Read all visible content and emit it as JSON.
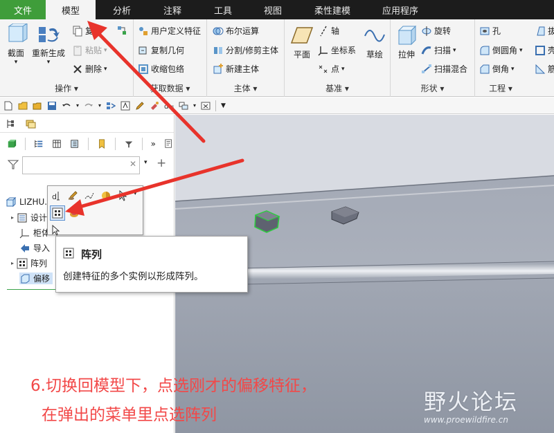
{
  "menu": {
    "tabs": [
      {
        "label": "文件"
      },
      {
        "label": "模型"
      },
      {
        "label": "分析"
      },
      {
        "label": "注释"
      },
      {
        "label": "工具"
      },
      {
        "label": "视图"
      },
      {
        "label": "柔性建模"
      },
      {
        "label": "应用程序"
      }
    ],
    "active": "模型"
  },
  "ribbon": {
    "operations": {
      "label": "操作",
      "section": "截面",
      "regenerate": "重新生成",
      "copy": "复制",
      "paste": "粘贴",
      "delete": "删除"
    },
    "get_data": {
      "label": "获取数据",
      "udf": "用户定义特征",
      "copy_geometry": "复制几何",
      "shrinkwrap": "收缩包络"
    },
    "body": {
      "label": "主体",
      "boolean": "布尔运算",
      "split_trim": "分割/修剪主体",
      "new_body": "新建主体"
    },
    "datum": {
      "label": "基准",
      "plane": "平面",
      "axis": "轴",
      "csys": "坐标系",
      "point": "点",
      "sketch": "草绘"
    },
    "shapes": {
      "label": "形状",
      "extrude": "拉伸",
      "revolve": "旋转",
      "sweep": "扫描",
      "swept_blend": "扫描混合"
    },
    "engineering": {
      "label": "工程",
      "hole": "孔",
      "round": "倒圆角",
      "chamfer": "倒角",
      "draft": "拔",
      "shell": "壳",
      "rib": "筋"
    }
  },
  "tree": {
    "root": "LIZHU...",
    "items": [
      {
        "label": "设计"
      },
      {
        "label": "柜体"
      },
      {
        "label": "导入"
      },
      {
        "label": "阵列"
      },
      {
        "label": "偏移"
      }
    ]
  },
  "tooltip": {
    "title": "阵列",
    "description": "创建特征的多个实例以形成阵列。"
  },
  "annotation": {
    "line1": "6.切换回模型下，点选刚才的偏移特征，",
    "line2": "在弹出的菜单里点选阵列"
  },
  "watermark": {
    "text": "野火论坛",
    "url": "www.proewildfire.cn"
  },
  "colors": {
    "file_tab": "#3f9d3a",
    "menubar": "#1c1c1c",
    "annotation": "#f24848",
    "arrow": "#e8332b",
    "selection_green": "#2ecc40"
  }
}
